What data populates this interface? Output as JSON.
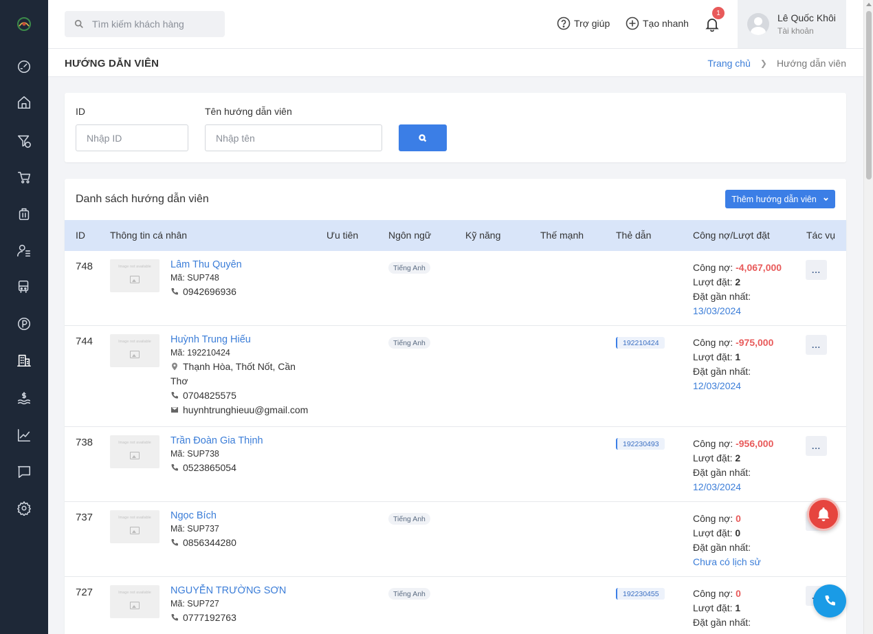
{
  "topbar": {
    "search_placeholder": "Tìm kiếm khách hàng",
    "help_label": "Trợ giúp",
    "quick_create_label": "Tạo nhanh",
    "notification_count": "1",
    "user_name": "Lê Quốc Khôi",
    "user_sub": "Tài khoản"
  },
  "sidebar": {
    "items": [
      {
        "icon": "dashboard-icon"
      },
      {
        "icon": "home-icon"
      },
      {
        "icon": "filter-money-icon"
      },
      {
        "icon": "cart-icon"
      },
      {
        "icon": "suitcase-icon"
      },
      {
        "icon": "user-list-icon"
      },
      {
        "icon": "bus-icon"
      },
      {
        "icon": "parking-icon"
      },
      {
        "icon": "building-icon"
      },
      {
        "icon": "money-wave-icon"
      },
      {
        "icon": "chart-icon"
      },
      {
        "icon": "chat-icon"
      },
      {
        "icon": "settings-icon"
      }
    ]
  },
  "page": {
    "title": "HƯỚNG DẪN VIÊN",
    "breadcrumb_home": "Trang chủ",
    "breadcrumb_current": "Hướng dẫn viên"
  },
  "filter": {
    "id_label": "ID",
    "id_placeholder": "Nhập ID",
    "name_label": "Tên hướng dẫn viên",
    "name_placeholder": "Nhập tên"
  },
  "list": {
    "title": "Danh sách hướng dẫn viên",
    "add_button": "Thêm hướng dẫn viên",
    "columns": {
      "id": "ID",
      "info": "Thông tin cá nhân",
      "priority": "Ưu tiên",
      "language": "Ngôn ngữ",
      "skills": "Kỹ năng",
      "strengths": "Thế mạnh",
      "card": "Thẻ dẫn",
      "debt": "Công nợ/Lượt đặt",
      "actions": "Tác vụ"
    },
    "image_placeholder": "Image not available",
    "debt_label": "Công nợ:",
    "bookings_label": "Lượt đặt:",
    "latest_label": "Đặt gần nhất:",
    "action_label": "...",
    "rows": [
      {
        "id": "748",
        "name": "Lâm Thu Quyên",
        "code": "Mã: SUP748",
        "phone": "0942696936",
        "language": "Tiếng Anh",
        "card": "",
        "debt": "-4,067,000",
        "bookings": "2",
        "latest": "13/03/2024"
      },
      {
        "id": "744",
        "name": "Huỳnh Trung Hiếu",
        "code": "Mã: 192210424",
        "address_line1": "Thạnh Hòa, Thốt Nốt, Cần",
        "address_line2": "Thơ",
        "phone": "0704825575",
        "email": "huynhtrunghieuu@gmail.com",
        "language": "Tiếng Anh",
        "card": "192210424",
        "debt": "-975,000",
        "bookings": "1",
        "latest": "12/03/2024"
      },
      {
        "id": "738",
        "name": "Trần Đoàn Gia Thịnh",
        "code": "Mã: SUP738",
        "phone": "0523865054",
        "language": "",
        "card": "192230493",
        "debt": "-956,000",
        "bookings": "2",
        "latest": "12/03/2024"
      },
      {
        "id": "737",
        "name": "Ngọc Bích",
        "code": "Mã: SUP737",
        "phone": "0856344280",
        "language": "Tiếng Anh",
        "card": "",
        "debt": "0",
        "bookings": "0",
        "latest": "Chưa có lịch sử"
      },
      {
        "id": "727",
        "name": "NGUYỄN TRƯỜNG SƠN",
        "code": "Mã: SUP727",
        "phone": "0777192763",
        "language": "Tiếng Anh",
        "card": "192230455",
        "debt": "0",
        "bookings": "1",
        "latest": ""
      }
    ]
  },
  "colors": {
    "sidebar": "#1e2837",
    "primary": "#3b7ee6",
    "negative": "#e85a5a",
    "header_row": "#d9e5f9"
  }
}
